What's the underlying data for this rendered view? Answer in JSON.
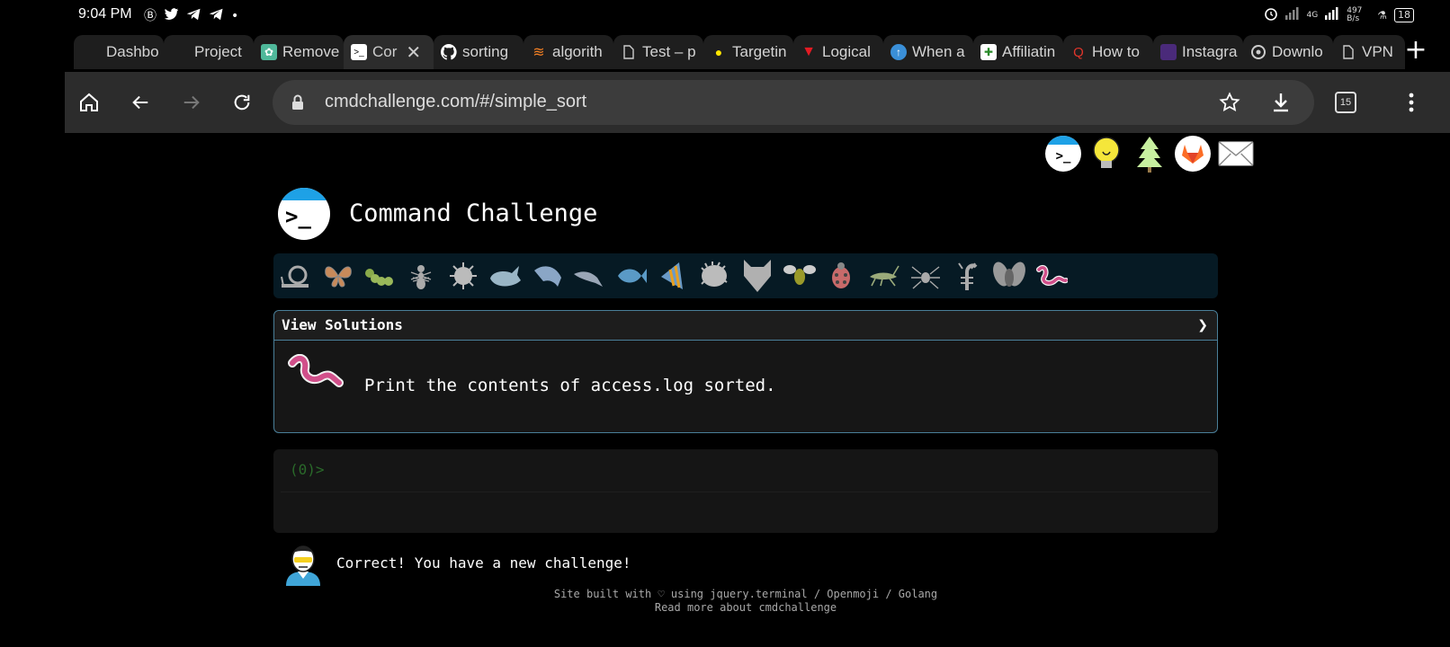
{
  "status_bar": {
    "time": "9:04 PM",
    "notification_icons": [
      "b-circle-icon",
      "twitter-icon",
      "telegram-icon",
      "telegram-icon",
      "dot-icon"
    ],
    "network": "4G",
    "speed": "497 B/s",
    "battery": "18"
  },
  "tabs": [
    {
      "label": "Dashbo",
      "icon": "blank-icon"
    },
    {
      "label": "Project",
      "icon": "blank-icon"
    },
    {
      "label": "Remove",
      "icon": "openai-icon"
    },
    {
      "label": "Cor",
      "icon": "terminal-icon",
      "active": true
    },
    {
      "label": "sorting",
      "icon": "github-icon"
    },
    {
      "label": "algorith",
      "icon": "stackoverflow-icon"
    },
    {
      "label": "Test – p",
      "icon": "page-icon"
    },
    {
      "label": "Targetin",
      "icon": "bulb-icon"
    },
    {
      "label": "Logical",
      "icon": "red-v-icon"
    },
    {
      "label": "When a",
      "icon": "upvote-icon"
    },
    {
      "label": "Affiliatin",
      "icon": "green-icon"
    },
    {
      "label": "How to",
      "icon": "quora-icon"
    },
    {
      "label": "Instagra",
      "icon": "purple-icon"
    },
    {
      "label": "Downlo",
      "icon": "chrome-icon"
    },
    {
      "label": "VPN",
      "icon": "page-icon"
    }
  ],
  "toolbar": {
    "url": "cmdchallenge.com/#/simple_sort",
    "tab_count": "15"
  },
  "site": {
    "title": "Command Challenge",
    "header_icons": [
      "terminal-icon",
      "lightbulb-icon",
      "tree-icon",
      "gitlab-icon",
      "mail-icon"
    ],
    "levels": [
      "snail-icon",
      "butterfly-icon",
      "caterpillar-icon",
      "ant-icon",
      "microbe-icon",
      "whale-icon",
      "shark-icon",
      "dolphin-icon",
      "fish-icon",
      "tropical-fish-icon",
      "blowfish-icon",
      "wolf-icon",
      "bee-icon",
      "ladybug-icon",
      "cricket-icon",
      "spider-icon",
      "scorpion-icon",
      "fly-icon",
      "worm-icon"
    ],
    "solutions_label": "View Solutions",
    "solutions_chevron": "❯",
    "challenge_text": "Print the contents of access.log sorted.",
    "prompt": "(0)>",
    "feedback": "Correct! You have a new challenge!",
    "footer_line1": "Site built with ♡ using jquery.terminal / Openmoji / Golang",
    "footer_line2": "Read more about cmdchallenge"
  },
  "colors": {
    "accent_blue": "#1ea1e6",
    "border": "#4a7f99",
    "prompt_green": "#2a6a2a",
    "worm_pink": "#d14f8a"
  }
}
